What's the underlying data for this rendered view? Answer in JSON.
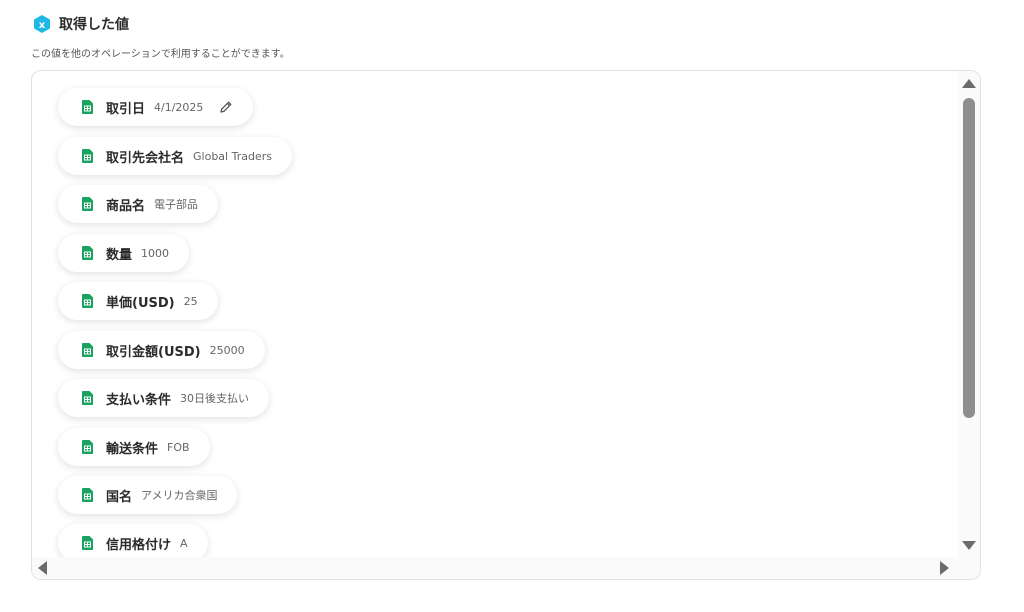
{
  "header": {
    "title": "取得した値",
    "description": "この値を他のオペレーションで利用することができます。",
    "icon": "x-hexagon-icon",
    "accent_color": "#1fb8e6"
  },
  "items": [
    {
      "label": "取引日",
      "value": "4/1/2025",
      "icon": "spreadsheet-icon",
      "editable": true
    },
    {
      "label": "取引先会社名",
      "value": "Global Traders",
      "icon": "spreadsheet-icon"
    },
    {
      "label": "商品名",
      "value": "電子部品",
      "icon": "spreadsheet-icon"
    },
    {
      "label": "数量",
      "value": "1000",
      "icon": "spreadsheet-icon"
    },
    {
      "label": "単価(USD)",
      "value": "25",
      "icon": "spreadsheet-icon"
    },
    {
      "label": "取引金額(USD)",
      "value": "25000",
      "icon": "spreadsheet-icon"
    },
    {
      "label": "支払い条件",
      "value": "30日後支払い",
      "icon": "spreadsheet-icon"
    },
    {
      "label": "輸送条件",
      "value": "FOB",
      "icon": "spreadsheet-icon"
    },
    {
      "label": "国名",
      "value": "アメリカ合衆国",
      "icon": "spreadsheet-icon"
    },
    {
      "label": "信用格付け",
      "value": "A",
      "icon": "spreadsheet-icon"
    }
  ],
  "colors": {
    "sheet_green": "#1aa260",
    "scrollbar_thumb": "#8e8e8e"
  }
}
